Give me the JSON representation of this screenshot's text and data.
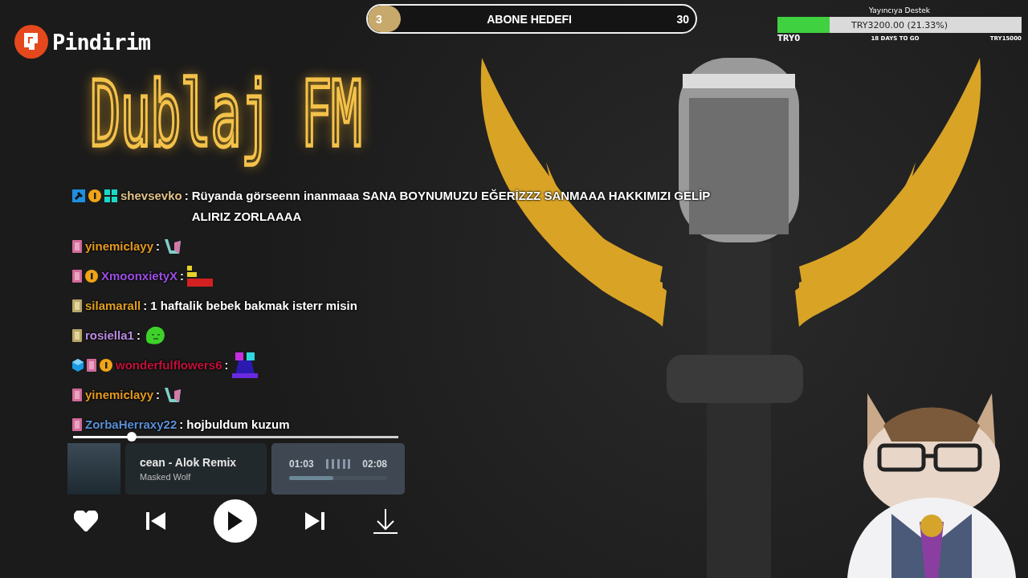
{
  "logo": {
    "text": "Pindirim"
  },
  "sub_goal": {
    "current": "3",
    "label": "ABONE HEDEFI",
    "target": "30",
    "level": 0.1
  },
  "donation_goal": {
    "title": "Yayıncıya Destek",
    "reading": "TRY3200.00 (21.33%)",
    "level": 0.2133,
    "start": "TRY0",
    "remaining": "18 DAYS TO GO",
    "end": "TRY15000"
  },
  "title": "Dublaj FM",
  "chat": [
    {
      "badges": [
        {
          "kind": "hammer"
        },
        {
          "kind": "coin"
        },
        {
          "kind": "grid"
        }
      ],
      "name": "shevsevko",
      "color": "#e3c38a",
      "separator": ":",
      "kind": "text",
      "message": "Rüyanda görseenn inanmaaa SANA BOYNUMUZU EĞERİZZZ SANMAAA HAKKIMIZI GELİP ALIRIZ ZORLAAAA"
    },
    {
      "badges": [
        {
          "kind": "card"
        }
      ],
      "name": "yinemiclayy",
      "color": "#e69a1e",
      "separator": ":",
      "kind": "wave"
    },
    {
      "badges": [
        {
          "kind": "card"
        },
        {
          "kind": "coin"
        }
      ],
      "name": "XmoonxietyX",
      "color": "#9c4de6",
      "separator": ":",
      "kind": "bars"
    },
    {
      "badges": [
        {
          "kind": "scroll"
        }
      ],
      "name": "silamarall",
      "color": "#e0a020",
      "separator": ":",
      "kind": "text",
      "message": "1 haftalik bebek bakmak isterr misin"
    },
    {
      "badges": [
        {
          "kind": "scroll"
        }
      ],
      "name": "rosiella1",
      "color": "#b98be3",
      "separator": ":",
      "kind": "blob"
    },
    {
      "badges": [
        {
          "kind": "cube"
        },
        {
          "kind": "card"
        },
        {
          "kind": "coin"
        }
      ],
      "name": "wonderfulflowers6",
      "color": "#c4103c",
      "separator": ":",
      "kind": "pixel"
    },
    {
      "badges": [
        {
          "kind": "card"
        }
      ],
      "name": "yinemiclayy",
      "color": "#e69a1e",
      "separator": ":",
      "kind": "wave"
    },
    {
      "badges": [
        {
          "kind": "card"
        }
      ],
      "name": "ZorbaHerraxy22",
      "color": "#5b8fd6",
      "separator": ":",
      "kind": "text",
      "message": "hojbuldum kuzum"
    }
  ],
  "player": {
    "seek": {
      "level": 0.18
    },
    "song": "cean - Alok Remix",
    "artist": "Masked Wolf",
    "elapsed": "01:03",
    "total": "02:08",
    "progress": {
      "level": 0.45
    },
    "liked": true
  }
}
